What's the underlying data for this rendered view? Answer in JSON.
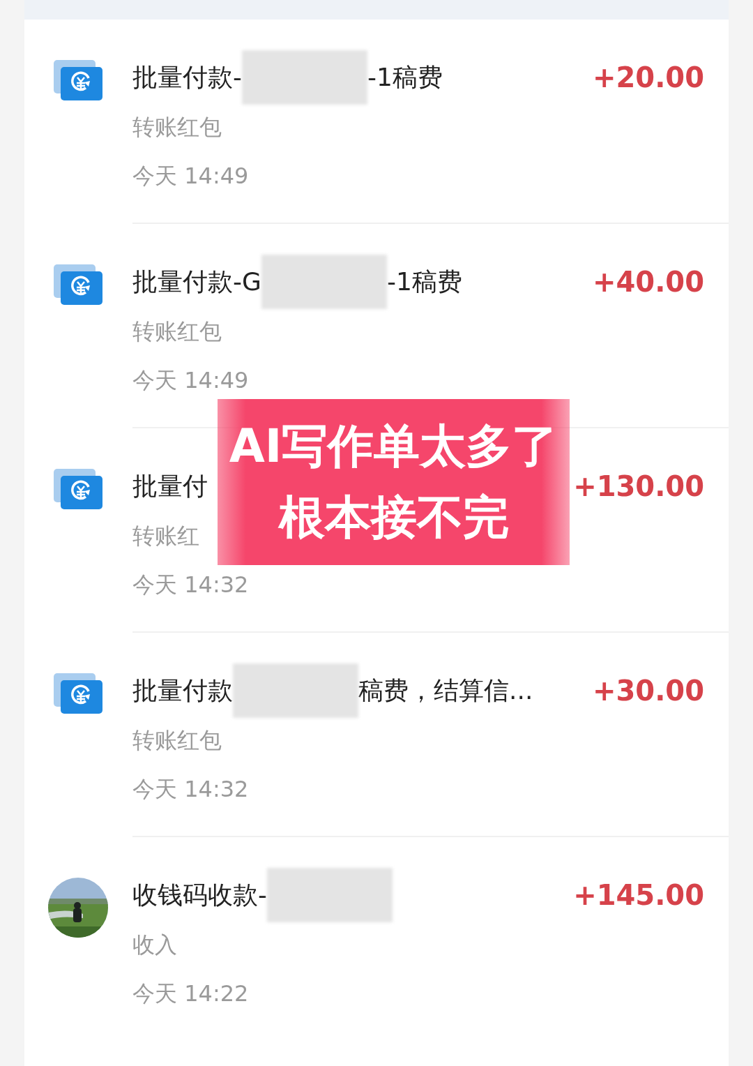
{
  "rows": [
    {
      "kind": "transfer",
      "title_start": "批量付款-",
      "redacted": true,
      "title_end": "-1稿费",
      "amount": "+20.00",
      "category": "转账红包",
      "time": "今天 14:49"
    },
    {
      "kind": "transfer",
      "title_start": "批量付款-G",
      "redacted": true,
      "title_end": "-1稿费",
      "amount": "+40.00",
      "category": "转账红包",
      "time": "今天 14:49"
    },
    {
      "kind": "transfer",
      "title_start": "批量付",
      "redacted": false,
      "amount": "+130.00",
      "category": "转账红",
      "time": "今天 14:32"
    },
    {
      "kind": "transfer",
      "title_start": "批量付款",
      "redacted": true,
      "title_end": "稿费，结算信...",
      "amount": "+30.00",
      "category": "转账红包",
      "time": "今天 14:32"
    },
    {
      "kind": "picture",
      "title_start": "收钱码收款-",
      "redacted": true,
      "amount": "+145.00",
      "category": "收入",
      "time": "今天 14:22"
    }
  ],
  "overlay": {
    "lines": [
      "AI写作单太多了",
      "根本接不完"
    ]
  }
}
